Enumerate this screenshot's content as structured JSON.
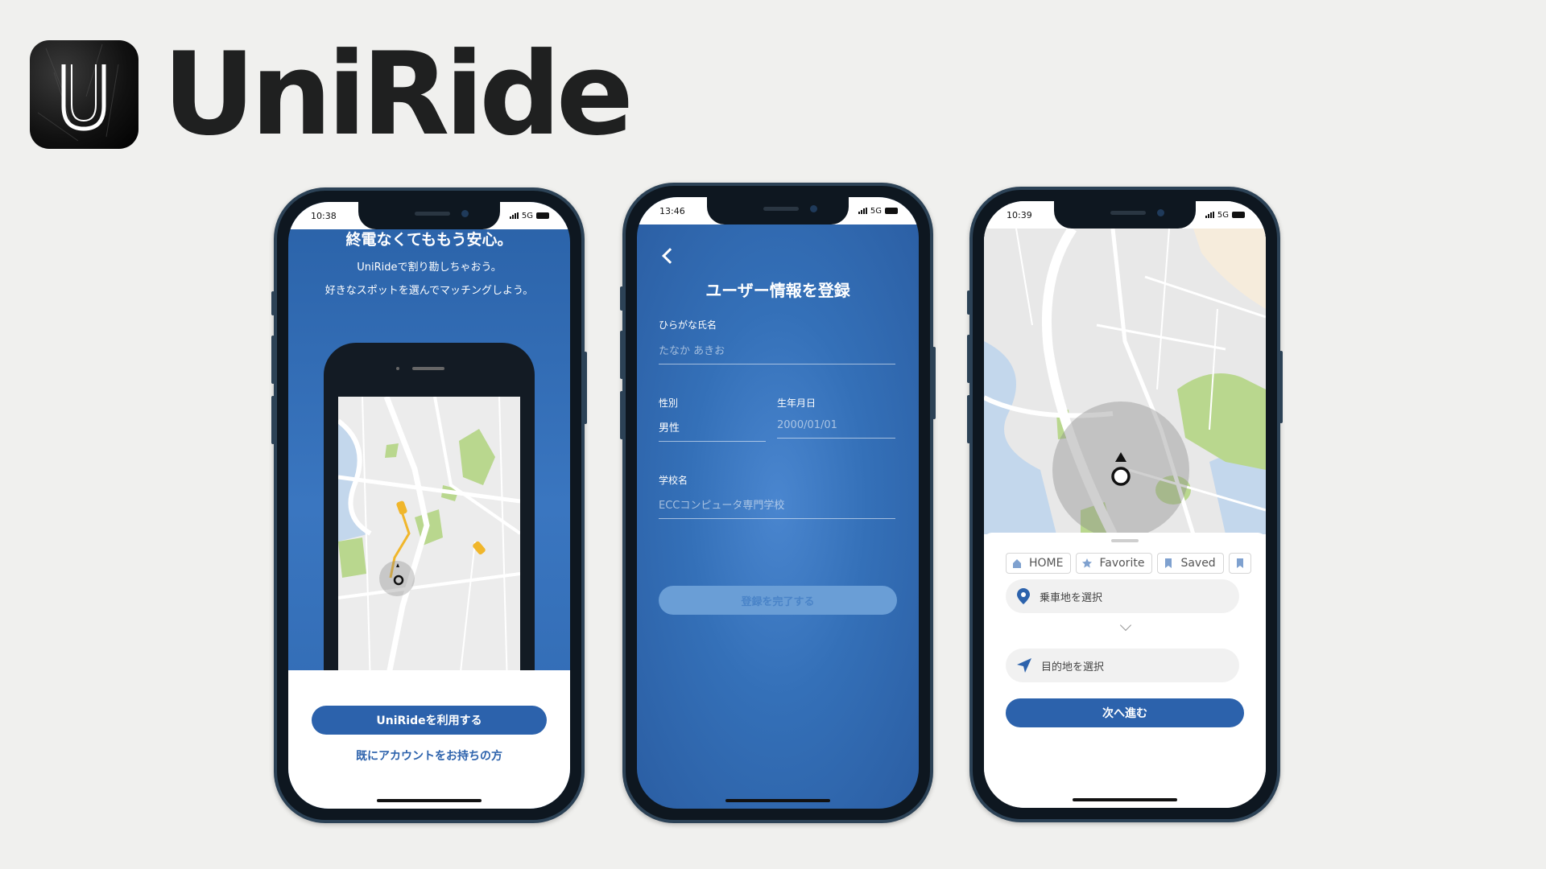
{
  "brand": {
    "name": "UniRide",
    "logo_letter": "U"
  },
  "phone1": {
    "time": "10:38",
    "network": "5G",
    "headline": "終電なくてももう安心。",
    "subline1": "UniRideで割り勘しちゃおう。",
    "subline2": "好きなスポットを選んでマッチングしよう。",
    "primary_button": "UniRideを利用する",
    "login_link": "既にアカウントをお持ちの方"
  },
  "phone2": {
    "time": "13:46",
    "network": "5G",
    "title": "ユーザー情報を登録",
    "fields": {
      "name_label": "ひらがな氏名",
      "name_placeholder": "たなか あきお",
      "gender_label": "性別",
      "gender_value": "男性",
      "birthday_label": "生年月日",
      "birthday_placeholder": "2000/01/01",
      "school_label": "学校名",
      "school_placeholder": "ECCコンピュータ専門学校"
    },
    "submit_button": "登録を完了する"
  },
  "phone3": {
    "time": "10:39",
    "network": "5G",
    "chips": [
      "HOME",
      "Favorite",
      "Saved"
    ],
    "pickup_placeholder": "乗車地を選択",
    "destination_placeholder": "目的地を選択",
    "next_button": "次へ進む"
  },
  "colors": {
    "accent": "#2c62ac",
    "background": "#f0f0ee",
    "brand_text": "#1f2020",
    "map_green": "#b9d78e",
    "map_water": "#c3d7ec"
  }
}
